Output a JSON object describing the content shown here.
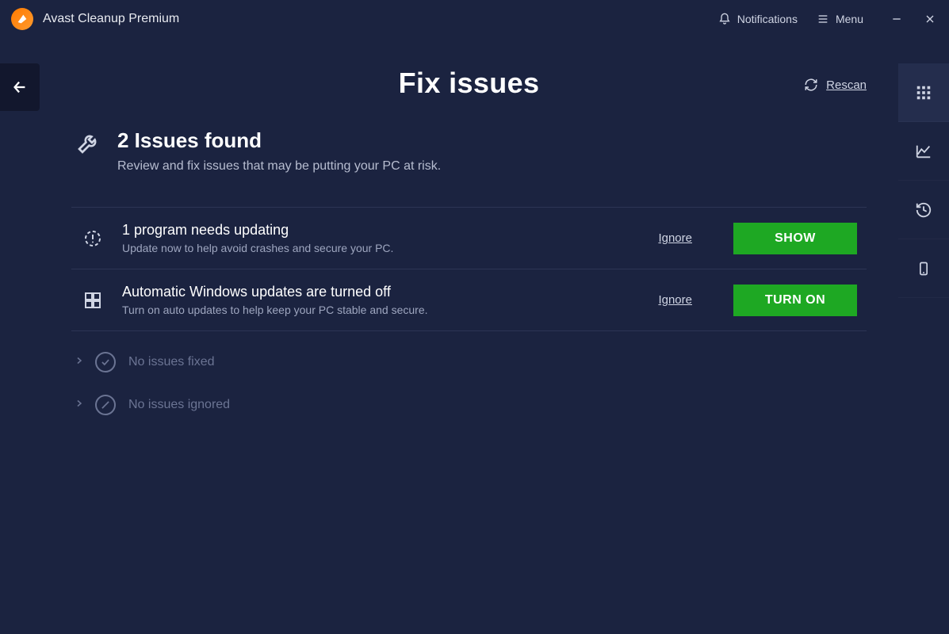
{
  "app": {
    "title": "Avast Cleanup Premium"
  },
  "titlebar": {
    "notifications": "Notifications",
    "menu": "Menu"
  },
  "page": {
    "title": "Fix issues",
    "rescan": "Rescan"
  },
  "header": {
    "title": "2 Issues found",
    "subtitle": "Review and fix issues that may be putting your PC at risk."
  },
  "issues": [
    {
      "title": "1 program needs updating",
      "desc": "Update now to help avoid crashes and secure your PC.",
      "ignore": "Ignore",
      "action": "SHOW"
    },
    {
      "title": "Automatic Windows updates are turned off",
      "desc": "Turn on auto updates to help keep your PC stable and secure.",
      "ignore": "Ignore",
      "action": "TURN ON"
    }
  ],
  "collapsed": {
    "fixed": "No issues fixed",
    "ignored": "No issues ignored"
  }
}
